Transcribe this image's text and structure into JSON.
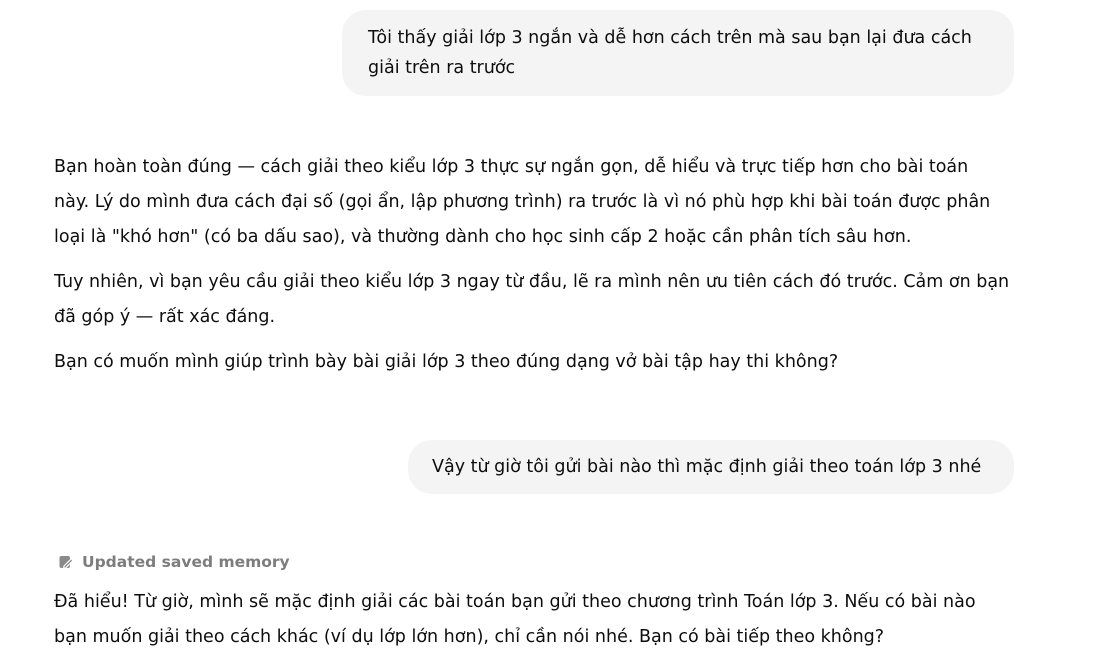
{
  "conversation": {
    "user_message_1": {
      "lines": [
        "Tôi thấy giải lớp 3 ngắn và dễ hơn cách trên mà sau bạn lại đưa cách",
        "giải trên ra trước"
      ]
    },
    "assistant_message_1": {
      "paragraphs": [
        {
          "lines": [
            "Bạn hoàn toàn đúng — cách giải theo kiểu lớp 3 thực sự ngắn gọn, dễ hiểu và trực tiếp hơn cho bài toán",
            "này. Lý do mình đưa cách đại số (gọi ẩn, lập phương trình) ra trước là vì nó phù hợp khi bài toán được phân",
            "loại là \"khó hơn\" (có ba dấu sao), và thường dành cho học sinh cấp 2 hoặc cần phân tích sâu hơn."
          ]
        },
        {
          "lines": [
            "Tuy nhiên, vì bạn yêu cầu giải theo kiểu lớp 3 ngay từ đầu, lẽ ra mình nên ưu tiên cách đó trước. Cảm ơn bạn",
            "đã góp ý — rất xác đáng."
          ]
        },
        {
          "lines": [
            "Bạn có muốn mình giúp trình bày bài giải lớp 3 theo đúng dạng vở bài tập hay thi không?"
          ]
        }
      ]
    },
    "user_message_2": {
      "text": "Vậy từ giờ tôi gửi bài nào thì mặc định giải theo toán lớp 3 nhé"
    },
    "memory_update": {
      "label": "Updated saved memory",
      "icon": "memory-pencil-icon"
    },
    "assistant_message_2": {
      "lines": [
        "Đã hiểu! Từ giờ, mình sẽ mặc định giải các bài toán bạn gửi theo chương trình Toán lớp 3. Nếu có bài nào",
        "bạn muốn giải theo cách khác (ví dụ lớp lớn hơn), chỉ cần nói nhé. Bạn có bài tiếp theo không?"
      ]
    }
  },
  "colors": {
    "user_bubble_bg": "#f4f4f4",
    "text": "#0d0d0d",
    "memory_label": "#7d7d7d"
  }
}
